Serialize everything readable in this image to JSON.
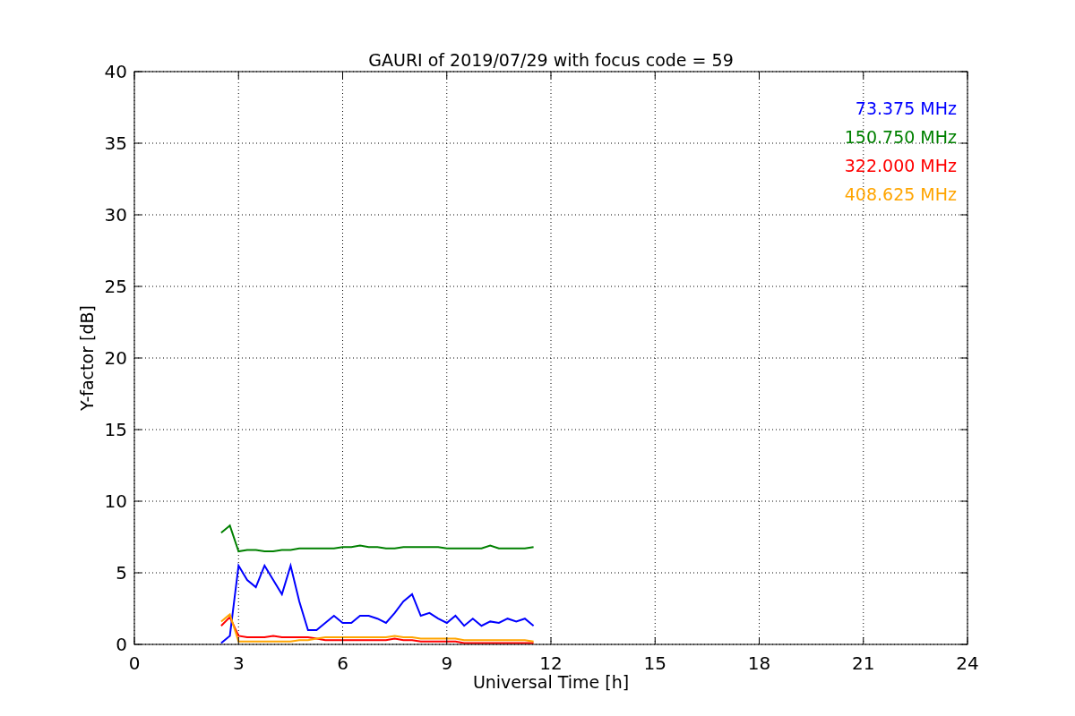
{
  "chart_data": {
    "type": "line",
    "title": "GAURI of 2019/07/29 with focus code = 59",
    "xlabel": "Universal Time [h]",
    "ylabel": "Y-factor [dB]",
    "x": [
      2.5,
      2.75,
      3.0,
      3.25,
      3.5,
      3.75,
      4.0,
      4.25,
      4.5,
      4.75,
      5.0,
      5.25,
      5.5,
      5.75,
      6.0,
      6.25,
      6.5,
      6.75,
      7.0,
      7.25,
      7.5,
      7.75,
      8.0,
      8.25,
      8.5,
      8.75,
      9.0,
      9.25,
      9.5,
      9.75,
      10.0,
      10.25,
      10.5,
      10.75,
      11.0,
      11.25,
      11.5
    ],
    "series": [
      {
        "name": "73.375 MHz",
        "color": "#0000ff",
        "values": [
          0.1,
          0.6,
          5.5,
          4.5,
          4.0,
          5.5,
          4.5,
          3.5,
          5.5,
          3.0,
          1.0,
          1.0,
          1.5,
          2.0,
          1.5,
          1.5,
          2.0,
          2.0,
          1.8,
          1.5,
          2.2,
          3.0,
          3.5,
          2.0,
          2.2,
          1.8,
          1.5,
          2.0,
          1.3,
          1.8,
          1.3,
          1.6,
          1.5,
          1.8,
          1.6,
          1.8,
          1.3
        ]
      },
      {
        "name": "150.750 MHz",
        "color": "#008000",
        "values": [
          7.8,
          8.3,
          6.5,
          6.6,
          6.6,
          6.5,
          6.5,
          6.6,
          6.6,
          6.7,
          6.7,
          6.7,
          6.7,
          6.7,
          6.8,
          6.8,
          6.9,
          6.8,
          6.8,
          6.7,
          6.7,
          6.8,
          6.8,
          6.8,
          6.8,
          6.8,
          6.7,
          6.7,
          6.7,
          6.7,
          6.7,
          6.9,
          6.7,
          6.7,
          6.7,
          6.7,
          6.8
        ]
      },
      {
        "name": "322.000 MHz",
        "color": "#ff0000",
        "values": [
          1.3,
          1.9,
          0.6,
          0.5,
          0.5,
          0.5,
          0.6,
          0.5,
          0.5,
          0.5,
          0.5,
          0.4,
          0.3,
          0.3,
          0.3,
          0.3,
          0.3,
          0.3,
          0.3,
          0.3,
          0.4,
          0.3,
          0.3,
          0.2,
          0.2,
          0.2,
          0.2,
          0.2,
          0.1,
          0.1,
          0.1,
          0.1,
          0.1,
          0.1,
          0.1,
          0.1,
          0.1
        ]
      },
      {
        "name": "408.625 MHz",
        "color": "#ffa500",
        "values": [
          1.6,
          2.1,
          0.2,
          0.2,
          0.2,
          0.2,
          0.2,
          0.2,
          0.2,
          0.3,
          0.3,
          0.4,
          0.5,
          0.5,
          0.5,
          0.5,
          0.5,
          0.5,
          0.5,
          0.5,
          0.6,
          0.5,
          0.5,
          0.4,
          0.4,
          0.4,
          0.4,
          0.4,
          0.3,
          0.3,
          0.3,
          0.3,
          0.3,
          0.3,
          0.3,
          0.3,
          0.2
        ]
      }
    ],
    "xlim": [
      0,
      24
    ],
    "ylim": [
      0,
      40
    ],
    "xticks": [
      0,
      3,
      6,
      9,
      12,
      15,
      18,
      21,
      24
    ],
    "yticks": [
      0,
      5,
      10,
      15,
      20,
      25,
      30,
      35,
      40
    ],
    "grid": true
  }
}
